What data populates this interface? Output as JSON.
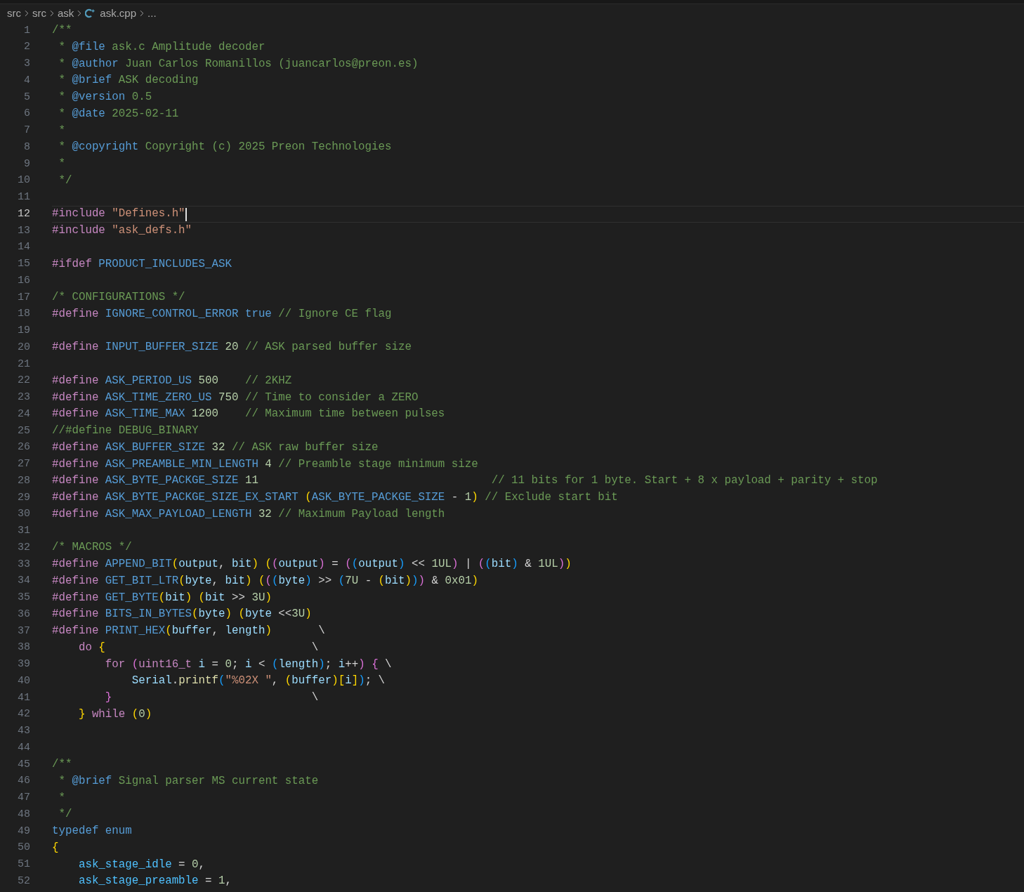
{
  "breadcrumb": [
    {
      "label": "src",
      "kind": "folder"
    },
    {
      "label": "src",
      "kind": "folder"
    },
    {
      "label": "ask",
      "kind": "folder"
    },
    {
      "label": "ask.cpp",
      "kind": "file"
    },
    {
      "label": "...",
      "kind": "more"
    }
  ],
  "lines": [
    {
      "number": "1",
      "current": false,
      "tokens": [
        {
          "kind": "comment",
          "text": "/**"
        }
      ]
    },
    {
      "number": "2",
      "current": false,
      "tokens": [
        {
          "kind": "comment",
          "text": " * "
        },
        {
          "kind": "doctag",
          "text": "@file"
        },
        {
          "kind": "comment",
          "text": " ask.c Amplitude decoder"
        }
      ]
    },
    {
      "number": "3",
      "current": false,
      "tokens": [
        {
          "kind": "comment",
          "text": " * "
        },
        {
          "kind": "doctag",
          "text": "@author"
        },
        {
          "kind": "comment",
          "text": " Juan Carlos Romanillos (juancarlos@preon.es)"
        }
      ]
    },
    {
      "number": "4",
      "current": false,
      "tokens": [
        {
          "kind": "comment",
          "text": " * "
        },
        {
          "kind": "doctag",
          "text": "@brief"
        },
        {
          "kind": "comment",
          "text": " ASK decoding"
        }
      ]
    },
    {
      "number": "5",
      "current": false,
      "tokens": [
        {
          "kind": "comment",
          "text": " * "
        },
        {
          "kind": "doctag",
          "text": "@version"
        },
        {
          "kind": "comment",
          "text": " 0.5"
        }
      ]
    },
    {
      "number": "6",
      "current": false,
      "tokens": [
        {
          "kind": "comment",
          "text": " * "
        },
        {
          "kind": "doctag",
          "text": "@date"
        },
        {
          "kind": "comment",
          "text": " 2025-02-11"
        }
      ]
    },
    {
      "number": "7",
      "current": false,
      "tokens": [
        {
          "kind": "comment",
          "text": " *"
        }
      ]
    },
    {
      "number": "8",
      "current": false,
      "tokens": [
        {
          "kind": "comment",
          "text": " * "
        },
        {
          "kind": "doctag",
          "text": "@copyright"
        },
        {
          "kind": "comment",
          "text": " Copyright (c) 2025 Preon Technologies"
        }
      ]
    },
    {
      "number": "9",
      "current": false,
      "tokens": [
        {
          "kind": "comment",
          "text": " *"
        }
      ]
    },
    {
      "number": "10",
      "current": false,
      "tokens": [
        {
          "kind": "comment",
          "text": " */"
        }
      ]
    },
    {
      "number": "11",
      "current": false
    },
    {
      "number": "12",
      "current": true,
      "tokens": [
        {
          "kind": "keyword",
          "text": "#include"
        },
        {
          "kind": "string",
          "text": " \"Defines.h\""
        }
      ]
    },
    {
      "number": "13",
      "current": false,
      "tokens": [
        {
          "kind": "keyword",
          "text": "#include"
        },
        {
          "kind": "string",
          "text": " \"ask_defs.h\""
        }
      ]
    },
    {
      "number": "14",
      "current": false
    },
    {
      "number": "15",
      "current": false,
      "tokens": [
        {
          "kind": "keyword",
          "text": "#ifdef"
        },
        {
          "kind": "macro",
          "text": " PRODUCT_INCLUDES_ASK"
        }
      ]
    },
    {
      "number": "16",
      "current": false
    },
    {
      "number": "17",
      "current": false,
      "tokens": [
        {
          "kind": "comment",
          "text": "/* CONFIGURATIONS */"
        }
      ]
    },
    {
      "number": "18",
      "current": false,
      "tokens": [
        {
          "kind": "keyword",
          "text": "#define"
        },
        {
          "kind": "macro",
          "text": " IGNORE_CONTROL_ERROR"
        },
        {
          "kind": "storage",
          "text": " true"
        },
        {
          "kind": "comment",
          "text": " // Ignore CE flag"
        }
      ]
    },
    {
      "number": "19",
      "current": false
    },
    {
      "number": "20",
      "current": false,
      "tokens": [
        {
          "kind": "keyword",
          "text": "#define"
        },
        {
          "kind": "macro",
          "text": " INPUT_BUFFER_SIZE"
        },
        {
          "kind": "number",
          "text": " 20"
        },
        {
          "kind": "comment",
          "text": " // ASK parsed buffer size"
        }
      ]
    },
    {
      "number": "21",
      "current": false
    },
    {
      "number": "22",
      "current": false,
      "tokens": [
        {
          "kind": "keyword",
          "text": "#define"
        },
        {
          "kind": "macro",
          "text": " ASK_PERIOD_US"
        },
        {
          "kind": "number",
          "text": " 500"
        },
        {
          "kind": "comment",
          "text": "    // 2KHZ"
        }
      ]
    },
    {
      "number": "23",
      "current": false,
      "tokens": [
        {
          "kind": "keyword",
          "text": "#define"
        },
        {
          "kind": "macro",
          "text": " ASK_TIME_ZERO_US"
        },
        {
          "kind": "number",
          "text": " 750"
        },
        {
          "kind": "comment",
          "text": " // Time to consider a ZERO"
        }
      ]
    },
    {
      "number": "24",
      "current": false,
      "tokens": [
        {
          "kind": "keyword",
          "text": "#define"
        },
        {
          "kind": "macro",
          "text": " ASK_TIME_MAX"
        },
        {
          "kind": "number",
          "text": " 1200"
        },
        {
          "kind": "comment",
          "text": "    // Maximum time between pulses"
        }
      ]
    },
    {
      "number": "25",
      "current": false,
      "tokens": [
        {
          "kind": "comment",
          "text": "//#define DEBUG_BINARY"
        }
      ]
    },
    {
      "number": "26",
      "current": false,
      "tokens": [
        {
          "kind": "keyword",
          "text": "#define"
        },
        {
          "kind": "macro",
          "text": " ASK_BUFFER_SIZE"
        },
        {
          "kind": "number",
          "text": " 32"
        },
        {
          "kind": "comment",
          "text": " // ASK raw buffer size"
        }
      ]
    },
    {
      "number": "27",
      "current": false,
      "tokens": [
        {
          "kind": "keyword",
          "text": "#define"
        },
        {
          "kind": "macro",
          "text": " ASK_PREAMBLE_MIN_LENGTH"
        },
        {
          "kind": "number",
          "text": " 4"
        },
        {
          "kind": "comment",
          "text": " // Preamble stage minimum size"
        }
      ]
    },
    {
      "number": "28",
      "current": false,
      "tokens": [
        {
          "kind": "keyword",
          "text": "#define"
        },
        {
          "kind": "macro",
          "text": " ASK_BYTE_PACKGE_SIZE"
        },
        {
          "kind": "number",
          "text": " 11"
        },
        {
          "kind": "comment",
          "text": "                                   // 11 bits for 1 byte. Start + 8 x payload + parity + stop"
        }
      ]
    },
    {
      "number": "29",
      "current": false,
      "tokens": [
        {
          "kind": "keyword",
          "text": "#define"
        },
        {
          "kind": "macro",
          "text": " ASK_BYTE_PACKGE_SIZE_EX_START"
        },
        {
          "kind": "bracket1",
          "text": " ("
        },
        {
          "kind": "macro",
          "text": "ASK_BYTE_PACKGE_SIZE"
        },
        {
          "kind": "text",
          "text": " - "
        },
        {
          "kind": "number",
          "text": "1"
        },
        {
          "kind": "bracket1",
          "text": ")"
        },
        {
          "kind": "comment",
          "text": " // Exclude start bit"
        }
      ]
    },
    {
      "number": "30",
      "current": false,
      "tokens": [
        {
          "kind": "keyword",
          "text": "#define"
        },
        {
          "kind": "macro",
          "text": " ASK_MAX_PAYLOAD_LENGTH"
        },
        {
          "kind": "number",
          "text": " 32"
        },
        {
          "kind": "comment",
          "text": " // Maximum Payload length"
        }
      ]
    },
    {
      "number": "31",
      "current": false
    },
    {
      "number": "32",
      "current": false,
      "tokens": [
        {
          "kind": "comment",
          "text": "/* MACROS */"
        }
      ]
    },
    {
      "number": "33",
      "current": false,
      "tokens": [
        {
          "kind": "keyword",
          "text": "#define"
        },
        {
          "kind": "macro",
          "text": " APPEND_BIT"
        },
        {
          "kind": "bracket1",
          "text": "("
        },
        {
          "kind": "param",
          "text": "output"
        },
        {
          "kind": "text",
          "text": ", "
        },
        {
          "kind": "param",
          "text": "bit"
        },
        {
          "kind": "bracket1",
          "text": ")"
        },
        {
          "kind": "bracket1",
          "text": " ("
        },
        {
          "kind": "bracket2",
          "text": "("
        },
        {
          "kind": "param",
          "text": "output"
        },
        {
          "kind": "bracket2",
          "text": ")"
        },
        {
          "kind": "text",
          "text": " = "
        },
        {
          "kind": "bracket2",
          "text": "("
        },
        {
          "kind": "bracket3",
          "text": "("
        },
        {
          "kind": "param",
          "text": "output"
        },
        {
          "kind": "bracket3",
          "text": ")"
        },
        {
          "kind": "text",
          "text": " << "
        },
        {
          "kind": "number",
          "text": "1UL"
        },
        {
          "kind": "bracket2",
          "text": ")"
        },
        {
          "kind": "text",
          "text": " | "
        },
        {
          "kind": "bracket2",
          "text": "("
        },
        {
          "kind": "bracket3",
          "text": "("
        },
        {
          "kind": "param",
          "text": "bit"
        },
        {
          "kind": "bracket3",
          "text": ")"
        },
        {
          "kind": "text",
          "text": " & "
        },
        {
          "kind": "number",
          "text": "1UL"
        },
        {
          "kind": "bracket2",
          "text": ")"
        },
        {
          "kind": "bracket1",
          "text": ")"
        }
      ]
    },
    {
      "number": "34",
      "current": false,
      "tokens": [
        {
          "kind": "keyword",
          "text": "#define"
        },
        {
          "kind": "macro",
          "text": " GET_BIT_LTR"
        },
        {
          "kind": "bracket1",
          "text": "("
        },
        {
          "kind": "param",
          "text": "byte"
        },
        {
          "kind": "text",
          "text": ", "
        },
        {
          "kind": "param",
          "text": "bit"
        },
        {
          "kind": "bracket1",
          "text": ")"
        },
        {
          "kind": "bracket1",
          "text": " ("
        },
        {
          "kind": "bracket2",
          "text": "("
        },
        {
          "kind": "bracket3",
          "text": "("
        },
        {
          "kind": "param",
          "text": "byte"
        },
        {
          "kind": "bracket3",
          "text": ")"
        },
        {
          "kind": "text",
          "text": " >> "
        },
        {
          "kind": "bracket3",
          "text": "("
        },
        {
          "kind": "number",
          "text": "7U"
        },
        {
          "kind": "text",
          "text": " - "
        },
        {
          "kind": "bracket1",
          "text": "("
        },
        {
          "kind": "param",
          "text": "bit"
        },
        {
          "kind": "bracket1",
          "text": ")"
        },
        {
          "kind": "bracket3",
          "text": ")"
        },
        {
          "kind": "bracket2",
          "text": ")"
        },
        {
          "kind": "text",
          "text": " & "
        },
        {
          "kind": "number",
          "text": "0x01"
        },
        {
          "kind": "bracket1",
          "text": ")"
        }
      ]
    },
    {
      "number": "35",
      "current": false,
      "tokens": [
        {
          "kind": "keyword",
          "text": "#define"
        },
        {
          "kind": "macro",
          "text": " GET_BYTE"
        },
        {
          "kind": "bracket1",
          "text": "("
        },
        {
          "kind": "param",
          "text": "bit"
        },
        {
          "kind": "bracket1",
          "text": ")"
        },
        {
          "kind": "bracket1",
          "text": " ("
        },
        {
          "kind": "param",
          "text": "bit"
        },
        {
          "kind": "text",
          "text": " >> "
        },
        {
          "kind": "number",
          "text": "3U"
        },
        {
          "kind": "bracket1",
          "text": ")"
        }
      ]
    },
    {
      "number": "36",
      "current": false,
      "tokens": [
        {
          "kind": "keyword",
          "text": "#define"
        },
        {
          "kind": "macro",
          "text": " BITS_IN_BYTES"
        },
        {
          "kind": "bracket1",
          "text": "("
        },
        {
          "kind": "param",
          "text": "byte"
        },
        {
          "kind": "bracket1",
          "text": ")"
        },
        {
          "kind": "bracket1",
          "text": " ("
        },
        {
          "kind": "param",
          "text": "byte"
        },
        {
          "kind": "text",
          "text": " <<"
        },
        {
          "kind": "number",
          "text": "3U"
        },
        {
          "kind": "bracket1",
          "text": ")"
        }
      ]
    },
    {
      "number": "37",
      "current": false,
      "tokens": [
        {
          "kind": "keyword",
          "text": "#define"
        },
        {
          "kind": "macro",
          "text": " PRINT_HEX"
        },
        {
          "kind": "bracket1",
          "text": "("
        },
        {
          "kind": "param",
          "text": "buffer"
        },
        {
          "kind": "text",
          "text": ", "
        },
        {
          "kind": "param",
          "text": "length"
        },
        {
          "kind": "bracket1",
          "text": ")"
        },
        {
          "kind": "text",
          "text": "       \\"
        }
      ]
    },
    {
      "number": "38",
      "current": false,
      "tokens": [
        {
          "kind": "keyword",
          "text": "    do"
        },
        {
          "kind": "bracket1",
          "text": " {"
        },
        {
          "kind": "text",
          "text": "                               \\"
        }
      ]
    },
    {
      "number": "39",
      "current": false,
      "tokens": [
        {
          "kind": "keyword",
          "text": "        for"
        },
        {
          "kind": "bracket2",
          "text": " ("
        },
        {
          "kind": "keyword",
          "text": "uint16_t"
        },
        {
          "kind": "param",
          "text": " i"
        },
        {
          "kind": "text",
          "text": " = "
        },
        {
          "kind": "number",
          "text": "0"
        },
        {
          "kind": "text",
          "text": "; "
        },
        {
          "kind": "param",
          "text": "i"
        },
        {
          "kind": "text",
          "text": " < "
        },
        {
          "kind": "bracket3",
          "text": "("
        },
        {
          "kind": "param",
          "text": "length"
        },
        {
          "kind": "bracket3",
          "text": ")"
        },
        {
          "kind": "text",
          "text": "; "
        },
        {
          "kind": "param",
          "text": "i"
        },
        {
          "kind": "text",
          "text": "++"
        },
        {
          "kind": "bracket2",
          "text": ")"
        },
        {
          "kind": "bracket2",
          "text": " {"
        },
        {
          "kind": "text",
          "text": " \\"
        }
      ]
    },
    {
      "number": "40",
      "current": false,
      "tokens": [
        {
          "kind": "param",
          "text": "            Serial"
        },
        {
          "kind": "text",
          "text": "."
        },
        {
          "kind": "func",
          "text": "printf"
        },
        {
          "kind": "bracket3",
          "text": "("
        },
        {
          "kind": "string",
          "text": "\"%02X \""
        },
        {
          "kind": "text",
          "text": ", "
        },
        {
          "kind": "bracket1",
          "text": "("
        },
        {
          "kind": "param",
          "text": "buffer"
        },
        {
          "kind": "bracket1",
          "text": ")"
        },
        {
          "kind": "bracket1",
          "text": "["
        },
        {
          "kind": "param",
          "text": "i"
        },
        {
          "kind": "bracket1",
          "text": "]"
        },
        {
          "kind": "bracket3",
          "text": ")"
        },
        {
          "kind": "text",
          "text": "; \\"
        }
      ]
    },
    {
      "number": "41",
      "current": false,
      "tokens": [
        {
          "kind": "bracket2",
          "text": "        }"
        },
        {
          "kind": "text",
          "text": "                              \\"
        }
      ]
    },
    {
      "number": "42",
      "current": false,
      "tokens": [
        {
          "kind": "bracket1",
          "text": "    }"
        },
        {
          "kind": "keyword",
          "text": " while"
        },
        {
          "kind": "bracket1",
          "text": " ("
        },
        {
          "kind": "number",
          "text": "0"
        },
        {
          "kind": "bracket1",
          "text": ")"
        }
      ]
    },
    {
      "number": "43",
      "current": false
    },
    {
      "number": "44",
      "current": false
    },
    {
      "number": "45",
      "current": false,
      "tokens": [
        {
          "kind": "comment",
          "text": "/**"
        }
      ]
    },
    {
      "number": "46",
      "current": false,
      "tokens": [
        {
          "kind": "comment",
          "text": " * "
        },
        {
          "kind": "doctag",
          "text": "@brief"
        },
        {
          "kind": "comment",
          "text": " Signal parser MS current state"
        }
      ]
    },
    {
      "number": "47",
      "current": false,
      "tokens": [
        {
          "kind": "comment",
          "text": " *"
        }
      ]
    },
    {
      "number": "48",
      "current": false,
      "tokens": [
        {
          "kind": "comment",
          "text": " */"
        }
      ]
    },
    {
      "number": "49",
      "current": false,
      "tokens": [
        {
          "kind": "storage",
          "text": "typedef"
        },
        {
          "kind": "storage",
          "text": " enum"
        }
      ]
    },
    {
      "number": "50",
      "current": false,
      "tokens": [
        {
          "kind": "bracket1",
          "text": "{"
        }
      ]
    },
    {
      "number": "51",
      "current": false,
      "tokens": [
        {
          "kind": "enum",
          "text": "    ask_stage_idle"
        },
        {
          "kind": "text",
          "text": " = "
        },
        {
          "kind": "number",
          "text": "0"
        },
        {
          "kind": "text",
          "text": ","
        }
      ]
    },
    {
      "number": "52",
      "current": false,
      "tokens": [
        {
          "kind": "enum",
          "text": "    ask_stage_preamble"
        },
        {
          "kind": "text",
          "text": " = "
        },
        {
          "kind": "number",
          "text": "1"
        },
        {
          "kind": "text",
          "text": ","
        }
      ]
    }
  ]
}
